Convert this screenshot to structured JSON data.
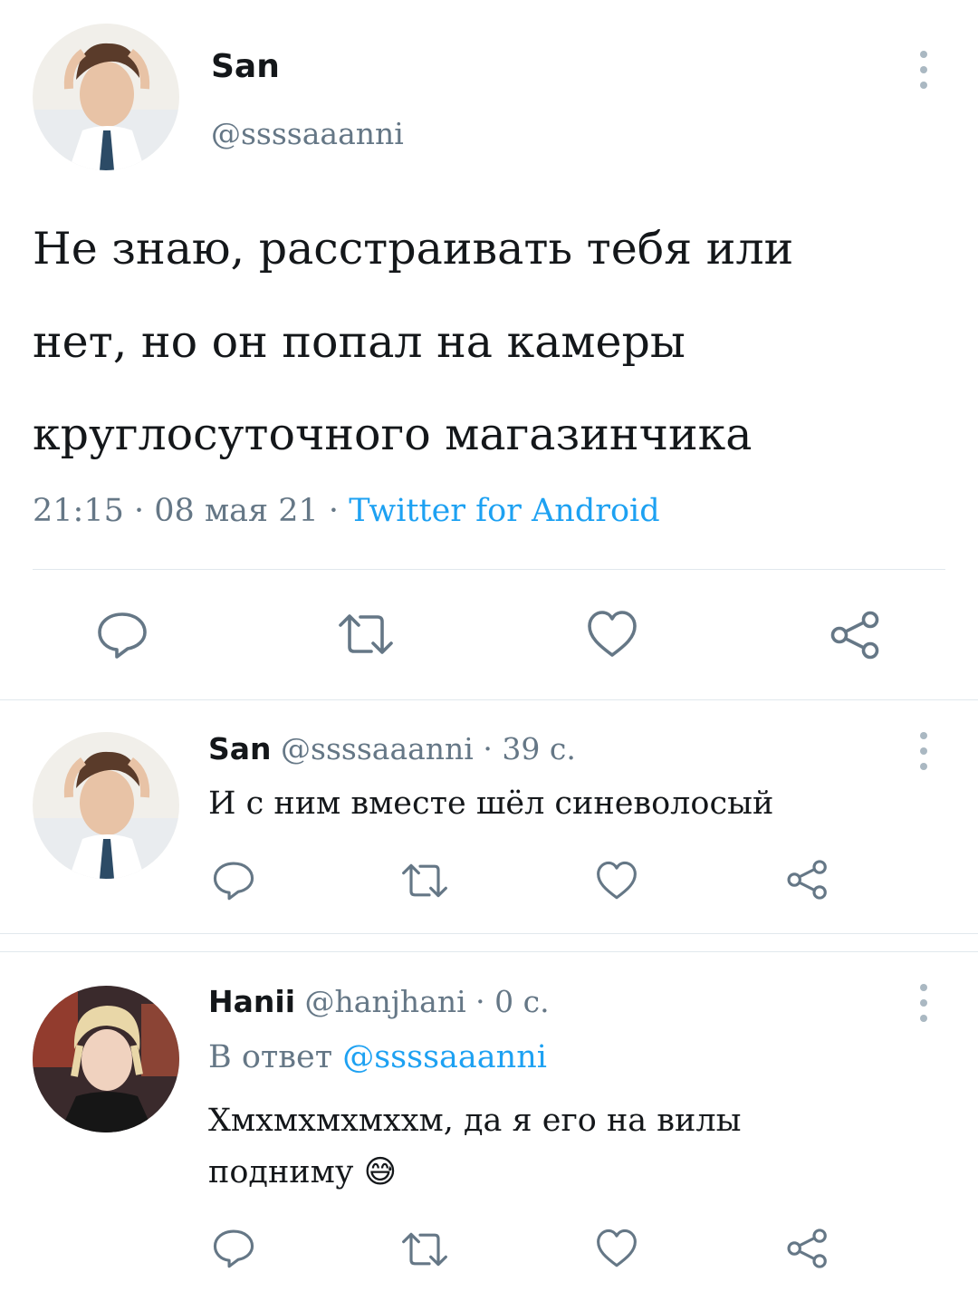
{
  "main_tweet": {
    "author_name": "San",
    "author_handle": "@ssssaaanni",
    "text_line1": "Не знаю, расстраивать тебя или",
    "text_line2": "нет, но он попал на камеры",
    "text_line3": "круглосуточного магазинчика",
    "time": "21:15",
    "date": "08 мая 21",
    "source": "Twitter for Android"
  },
  "reply1": {
    "author_name": "San",
    "author_handle": "@ssssaaanni",
    "age": "39 с.",
    "text": "И с ним вместе шёл синеволосый"
  },
  "reply2": {
    "author_name": "Hanii",
    "author_handle": "@hanjhani",
    "age": "0 с.",
    "reply_to_label": "В ответ",
    "reply_to_handle": "@ssssaaanni",
    "text_line1": "Хмхмхмхмххм, да я его на вилы",
    "text_line2": "подниму",
    "emoji": "😅"
  },
  "icons": {
    "reply": "reply-icon",
    "retweet": "retweet-icon",
    "like": "heart-icon",
    "share": "share-icon",
    "more": "more-vertical-icon"
  },
  "colors": {
    "link": "#1da1f2",
    "secondary_text": "#657786",
    "icon": "#657786",
    "divider": "#e1e8ed"
  }
}
